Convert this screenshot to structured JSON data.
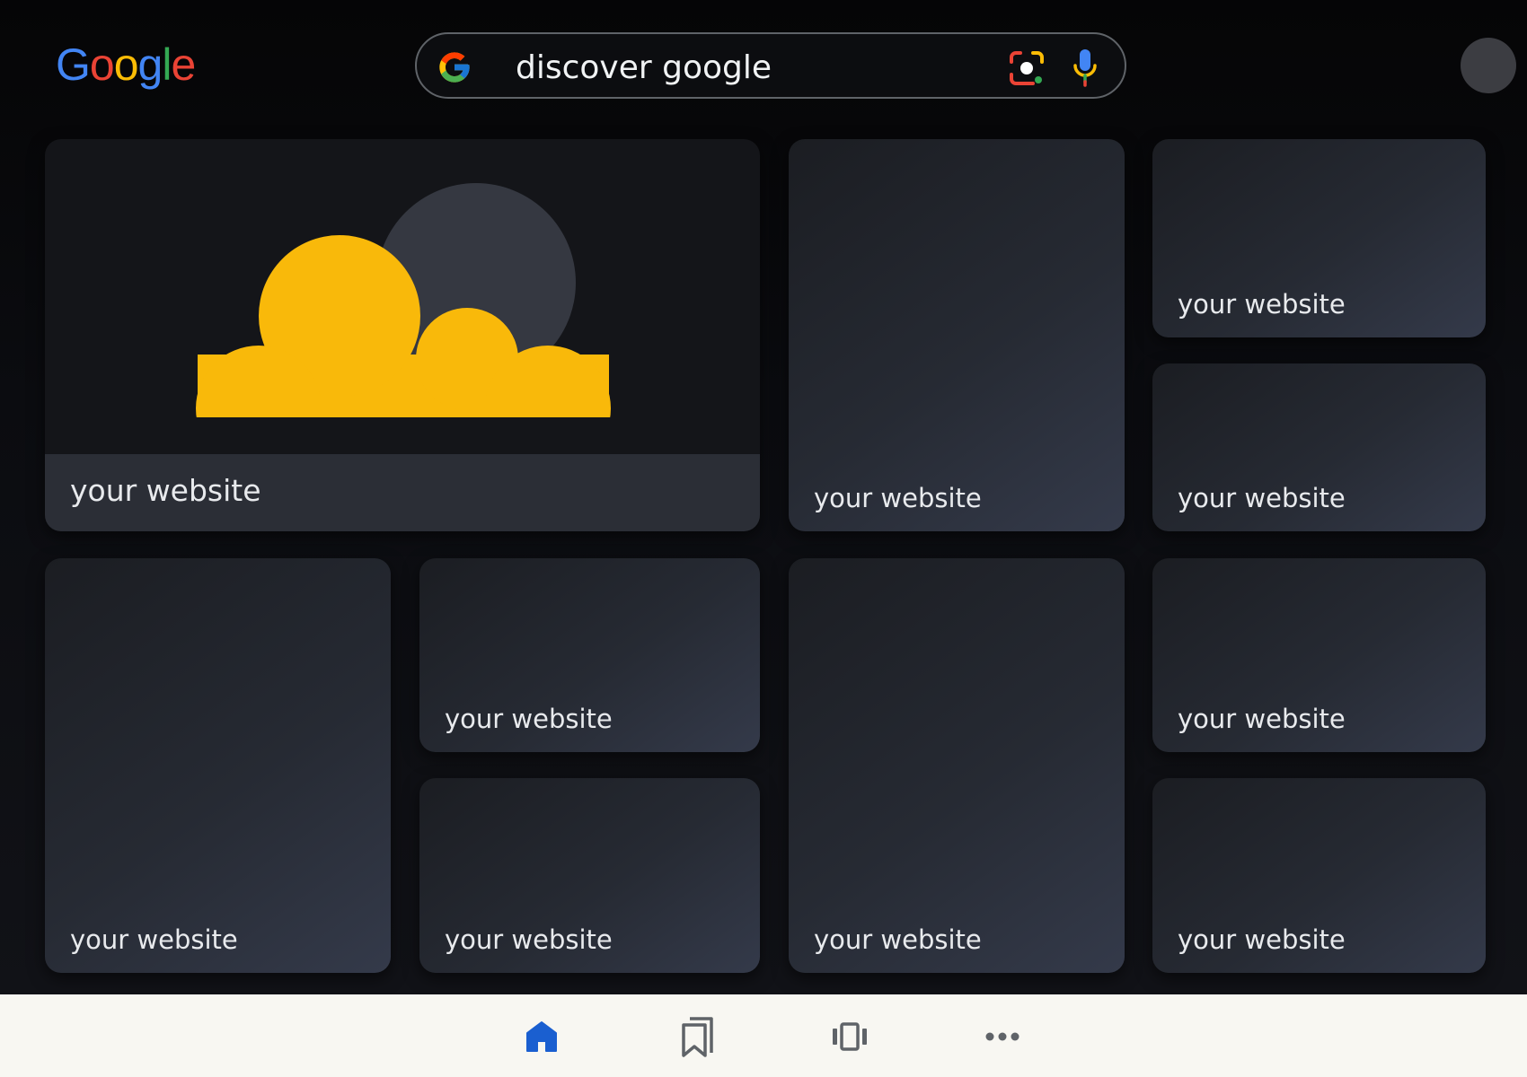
{
  "header": {
    "logo_letters": [
      "G",
      "o",
      "o",
      "g",
      "l",
      "e"
    ],
    "logo_colors": [
      "#4285F4",
      "#EA4335",
      "#FBBC05",
      "#4285F4",
      "#34A853",
      "#EA4335"
    ],
    "search": {
      "value": "discover google",
      "icons": [
        "google-g-icon",
        "google-lens-icon",
        "microphone-icon"
      ]
    },
    "avatar": "avatar"
  },
  "cards": [
    {
      "label": "your website",
      "type": "hero",
      "art": "cloud-and-moon"
    },
    {
      "label": "your website"
    },
    {
      "label": "your website"
    },
    {
      "label": "your website"
    },
    {
      "label": "your website"
    },
    {
      "label": "your website"
    },
    {
      "label": "your website"
    },
    {
      "label": "your website"
    },
    {
      "label": "your website"
    },
    {
      "label": "your website"
    }
  ],
  "colors": {
    "cloud": "#F9B90A",
    "moon": "#353841",
    "nav_active": "#1A5FD0",
    "nav_inactive": "#5F6368"
  },
  "bottom_nav": {
    "items": [
      {
        "icon": "home-icon",
        "active": true
      },
      {
        "icon": "bookmarks-icon",
        "active": false
      },
      {
        "icon": "carousel-icon",
        "active": false
      },
      {
        "icon": "more-icon",
        "active": false
      }
    ]
  }
}
